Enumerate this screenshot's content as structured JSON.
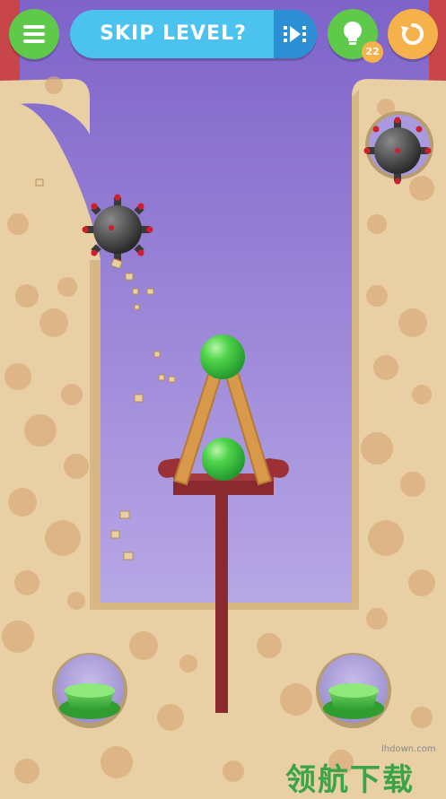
{
  "hud": {
    "skip_label": "SKIP LEVEL?",
    "hint_count": "22",
    "icons": {
      "menu": "hamburger-menu-icon",
      "skip_video": "video-ad-icon",
      "hint": "lightbulb-icon",
      "restart": "restart-arrow-icon"
    }
  },
  "colors": {
    "menu_button": "#5fc94a",
    "skip_pill": "#4cc3ee",
    "skip_video": "#2c8fd6",
    "hint_button": "#5fc94a",
    "restart_button": "#f6b24a",
    "sky_top": "#7e63c9",
    "sky_bottom": "#b8a9e6",
    "sand": "#e8cfa4",
    "green_ball": "#46c94a",
    "stand": "#8a2a2e",
    "wood_plank": "#d89a4a"
  },
  "watermark": {
    "url": "lhdown.com",
    "logo": "领航下载"
  }
}
